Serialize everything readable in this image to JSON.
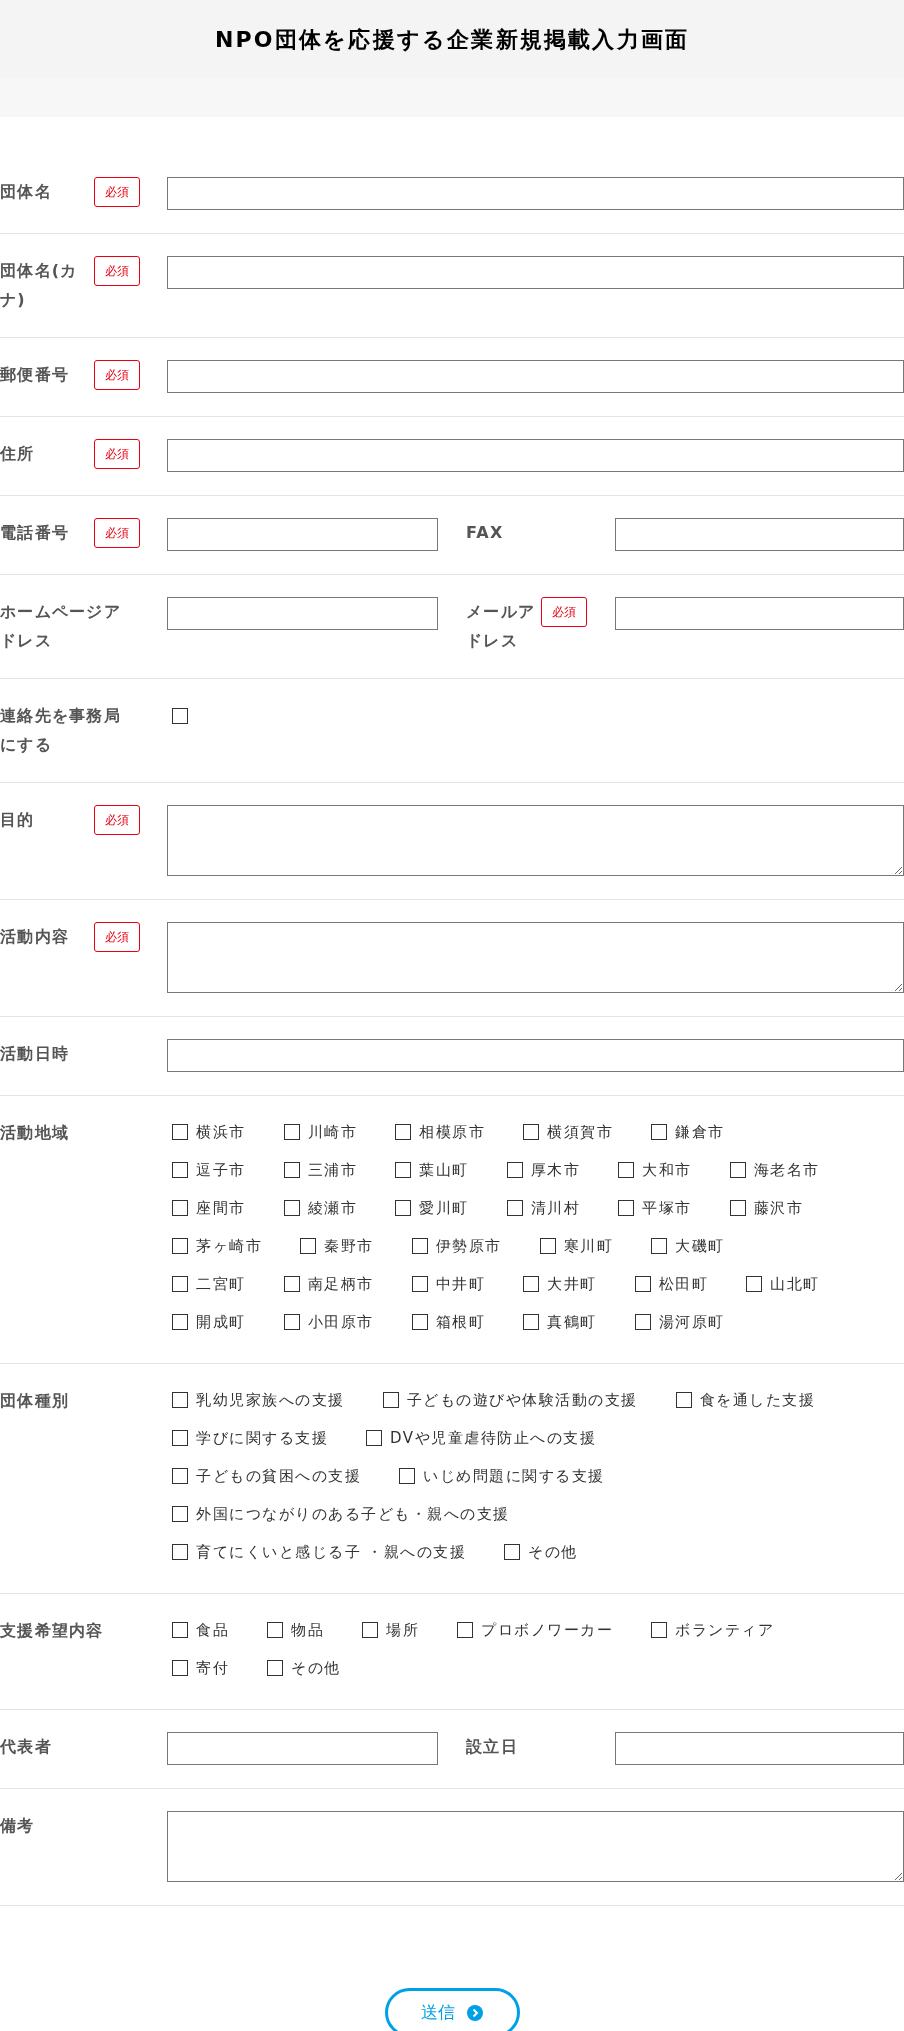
{
  "title": "NPO団体を応援する企業新規掲載入力画面",
  "fields": [
    {
      "kind": "text",
      "label": "団体名",
      "badge": "必須"
    },
    {
      "kind": "text",
      "label": "団体名(カナ)",
      "badge": "必須"
    },
    {
      "kind": "text",
      "label": "郵便番号",
      "badge": "必須"
    },
    {
      "kind": "text",
      "label": "住所",
      "badge": "必須"
    },
    {
      "kind": "pair",
      "items": [
        {
          "label": "電話番号",
          "badge": "必須"
        },
        {
          "label": "FAX"
        }
      ]
    },
    {
      "kind": "pair",
      "items": [
        {
          "label": "ホームページアドレス"
        },
        {
          "label": "メールアドレス",
          "badge": "必須"
        }
      ]
    },
    {
      "kind": "checkbox",
      "label": "連絡先を事務局にする",
      "checked": false
    },
    {
      "kind": "textarea",
      "label": "目的",
      "badge": "必須"
    },
    {
      "kind": "textarea",
      "label": "活動内容",
      "badge": "必須"
    },
    {
      "kind": "text",
      "label": "活動日時"
    },
    {
      "kind": "options",
      "label": "活動地域",
      "option_rows": [
        [
          {
            "label": "横浜市",
            "checked": false
          },
          {
            "label": "川崎市",
            "checked": false
          },
          {
            "label": "相模原市",
            "checked": false
          },
          {
            "label": "横須賀市",
            "checked": false
          },
          {
            "label": "鎌倉市",
            "checked": false
          }
        ],
        [
          {
            "label": "逗子市",
            "checked": false
          },
          {
            "label": "三浦市",
            "checked": false
          },
          {
            "label": "葉山町",
            "checked": false
          },
          {
            "label": "厚木市",
            "checked": false
          },
          {
            "label": "大和市",
            "checked": false
          },
          {
            "label": "海老名市",
            "checked": false
          }
        ],
        [
          {
            "label": "座間市",
            "checked": false
          },
          {
            "label": "綾瀬市",
            "checked": false
          },
          {
            "label": "愛川町",
            "checked": false
          },
          {
            "label": "清川村",
            "checked": false
          },
          {
            "label": "平塚市",
            "checked": false
          },
          {
            "label": "藤沢市",
            "checked": false
          }
        ],
        [
          {
            "label": "茅ヶ崎市",
            "checked": false
          },
          {
            "label": "秦野市",
            "checked": false
          },
          {
            "label": "伊勢原市",
            "checked": false
          },
          {
            "label": "寒川町",
            "checked": false
          },
          {
            "label": "大磯町",
            "checked": false
          }
        ],
        [
          {
            "label": "二宮町",
            "checked": false
          },
          {
            "label": "南足柄市",
            "checked": false
          },
          {
            "label": "中井町",
            "checked": false
          },
          {
            "label": "大井町",
            "checked": false
          },
          {
            "label": "松田町",
            "checked": false
          },
          {
            "label": "山北町",
            "checked": false
          }
        ],
        [
          {
            "label": "開成町",
            "checked": false
          },
          {
            "label": "小田原市",
            "checked": false
          },
          {
            "label": "箱根町",
            "checked": false
          },
          {
            "label": "真鶴町",
            "checked": false
          },
          {
            "label": "湯河原町",
            "checked": false
          }
        ]
      ]
    },
    {
      "kind": "options",
      "label": "団体種別",
      "option_rows": [
        [
          {
            "label": "乳幼児家族への支援",
            "checked": false
          },
          {
            "label": "子どもの遊びや体験活動の支援",
            "checked": false
          },
          {
            "label": "食を通した支援",
            "checked": false
          }
        ],
        [
          {
            "label": "学びに関する支援",
            "checked": false
          },
          {
            "label": "DVや児童虐待防止への支援",
            "checked": false
          }
        ],
        [
          {
            "label": "子どもの貧困への支援",
            "checked": false
          },
          {
            "label": "いじめ問題に関する支援",
            "checked": false
          }
        ],
        [
          {
            "label": "外国につながりのある子ども・親への支援",
            "checked": false
          }
        ],
        [
          {
            "label": "育てにくいと感じる子 ・親への支援",
            "checked": false
          },
          {
            "label": "その他",
            "checked": false
          }
        ]
      ]
    },
    {
      "kind": "options",
      "label": "支援希望内容",
      "option_rows": [
        [
          {
            "label": "食品",
            "checked": false
          },
          {
            "label": "物品",
            "checked": false
          },
          {
            "label": "場所",
            "checked": false
          },
          {
            "label": "プロボノワーカー",
            "checked": false
          },
          {
            "label": "ボランティア",
            "checked": false
          }
        ],
        [
          {
            "label": "寄付",
            "checked": false
          },
          {
            "label": "その他",
            "checked": false
          }
        ]
      ]
    },
    {
      "kind": "pair",
      "items": [
        {
          "label": "代表者"
        },
        {
          "label": "設立日"
        }
      ]
    },
    {
      "kind": "textarea",
      "label": "備考"
    }
  ],
  "submit_button": "送信"
}
